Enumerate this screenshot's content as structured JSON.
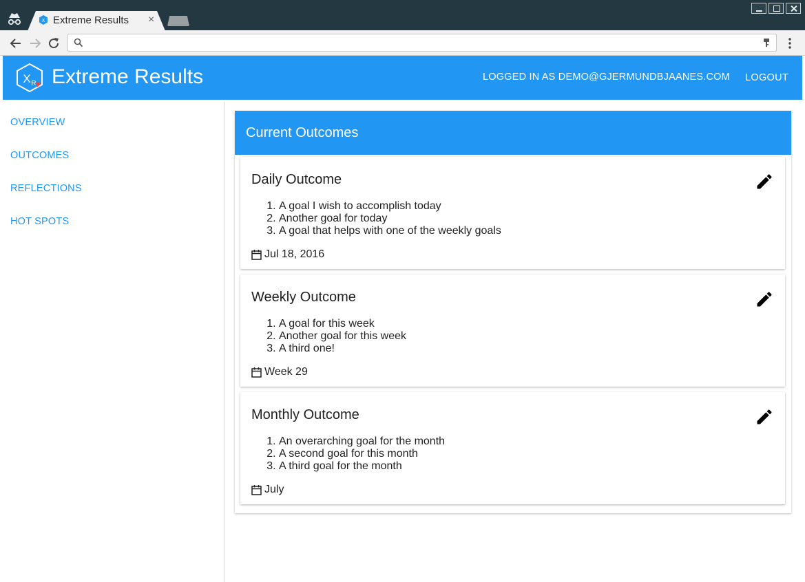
{
  "browser": {
    "tab_title": "Extreme Results",
    "tab_close": "×",
    "address_value": "",
    "icons": [
      "incognito-icon",
      "favicon-icon",
      "back-icon",
      "forward-icon",
      "reload-icon",
      "search-icon",
      "key-icon",
      "menu-icon"
    ]
  },
  "app": {
    "title": "Extreme Results",
    "logged_in": "LOGGED IN AS DEMO@GJERMUNDBJAANES.COM",
    "logout": "LOGOUT",
    "colors": {
      "primary": "#2196f3",
      "chrome": "#233840"
    }
  },
  "sidebar": {
    "items": [
      {
        "label": "OVERVIEW"
      },
      {
        "label": "OUTCOMES"
      },
      {
        "label": "REFLECTIONS"
      },
      {
        "label": "HOT SPOTS"
      }
    ]
  },
  "main": {
    "header": "Current Outcomes",
    "outcomes": [
      {
        "title": "Daily Outcome",
        "goals": [
          "A goal I wish to accomplish today",
          "Another goal for today",
          "A goal that helps with one of the weekly goals"
        ],
        "date": "Jul 18, 2016"
      },
      {
        "title": "Weekly Outcome",
        "goals": [
          "A goal for this week",
          "Another goal for this week",
          "A third one!"
        ],
        "date": "Week 29"
      },
      {
        "title": "Monthly Outcome",
        "goals": [
          "An overarching goal for the month",
          "A second goal for this month",
          "A third goal for the month"
        ],
        "date": "July"
      }
    ]
  }
}
